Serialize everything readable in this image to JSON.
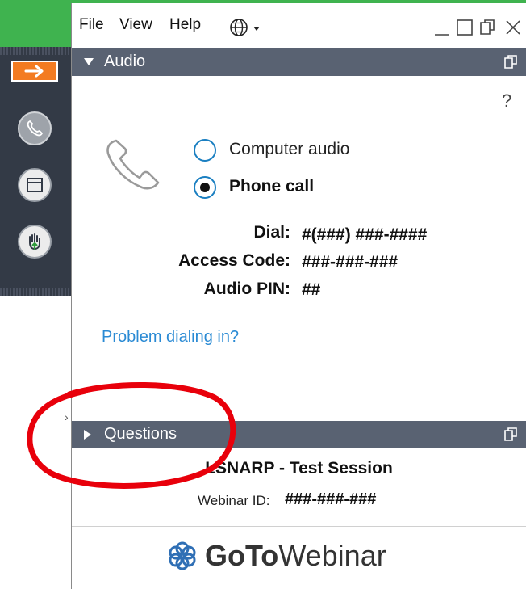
{
  "menu": {
    "items": [
      "File",
      "View",
      "Help"
    ],
    "language_icon": "globe-dropdown-icon"
  },
  "window_controls": [
    "minimize-icon",
    "maximize-icon",
    "popout-icon",
    "close-icon"
  ],
  "audio_panel": {
    "title": "Audio",
    "help": "?",
    "options": [
      {
        "label": "Computer audio",
        "selected": false
      },
      {
        "label": "Phone call",
        "selected": true
      }
    ],
    "dial_label": "Dial:",
    "dial_value": "#(###) ###-####",
    "access_code_label": "Access Code:",
    "access_code_value": "###-###-###",
    "audio_pin_label": "Audio PIN:",
    "audio_pin_value": "##",
    "problem_link": "Problem dialing in?"
  },
  "questions_panel": {
    "title": "Questions"
  },
  "session": {
    "name": "LSNARP - Test Session",
    "webinar_id_label": "Webinar ID:",
    "webinar_id_value": "###-###-###"
  },
  "brand": {
    "bold": "GoTo",
    "light": "Webinar"
  },
  "colors": {
    "header": "#596272",
    "accent_blue": "#1a7fc1",
    "link": "#2a8ad4",
    "orange": "#f37b21",
    "green": "#3fb34f",
    "annotation_red": "#e8000b"
  }
}
